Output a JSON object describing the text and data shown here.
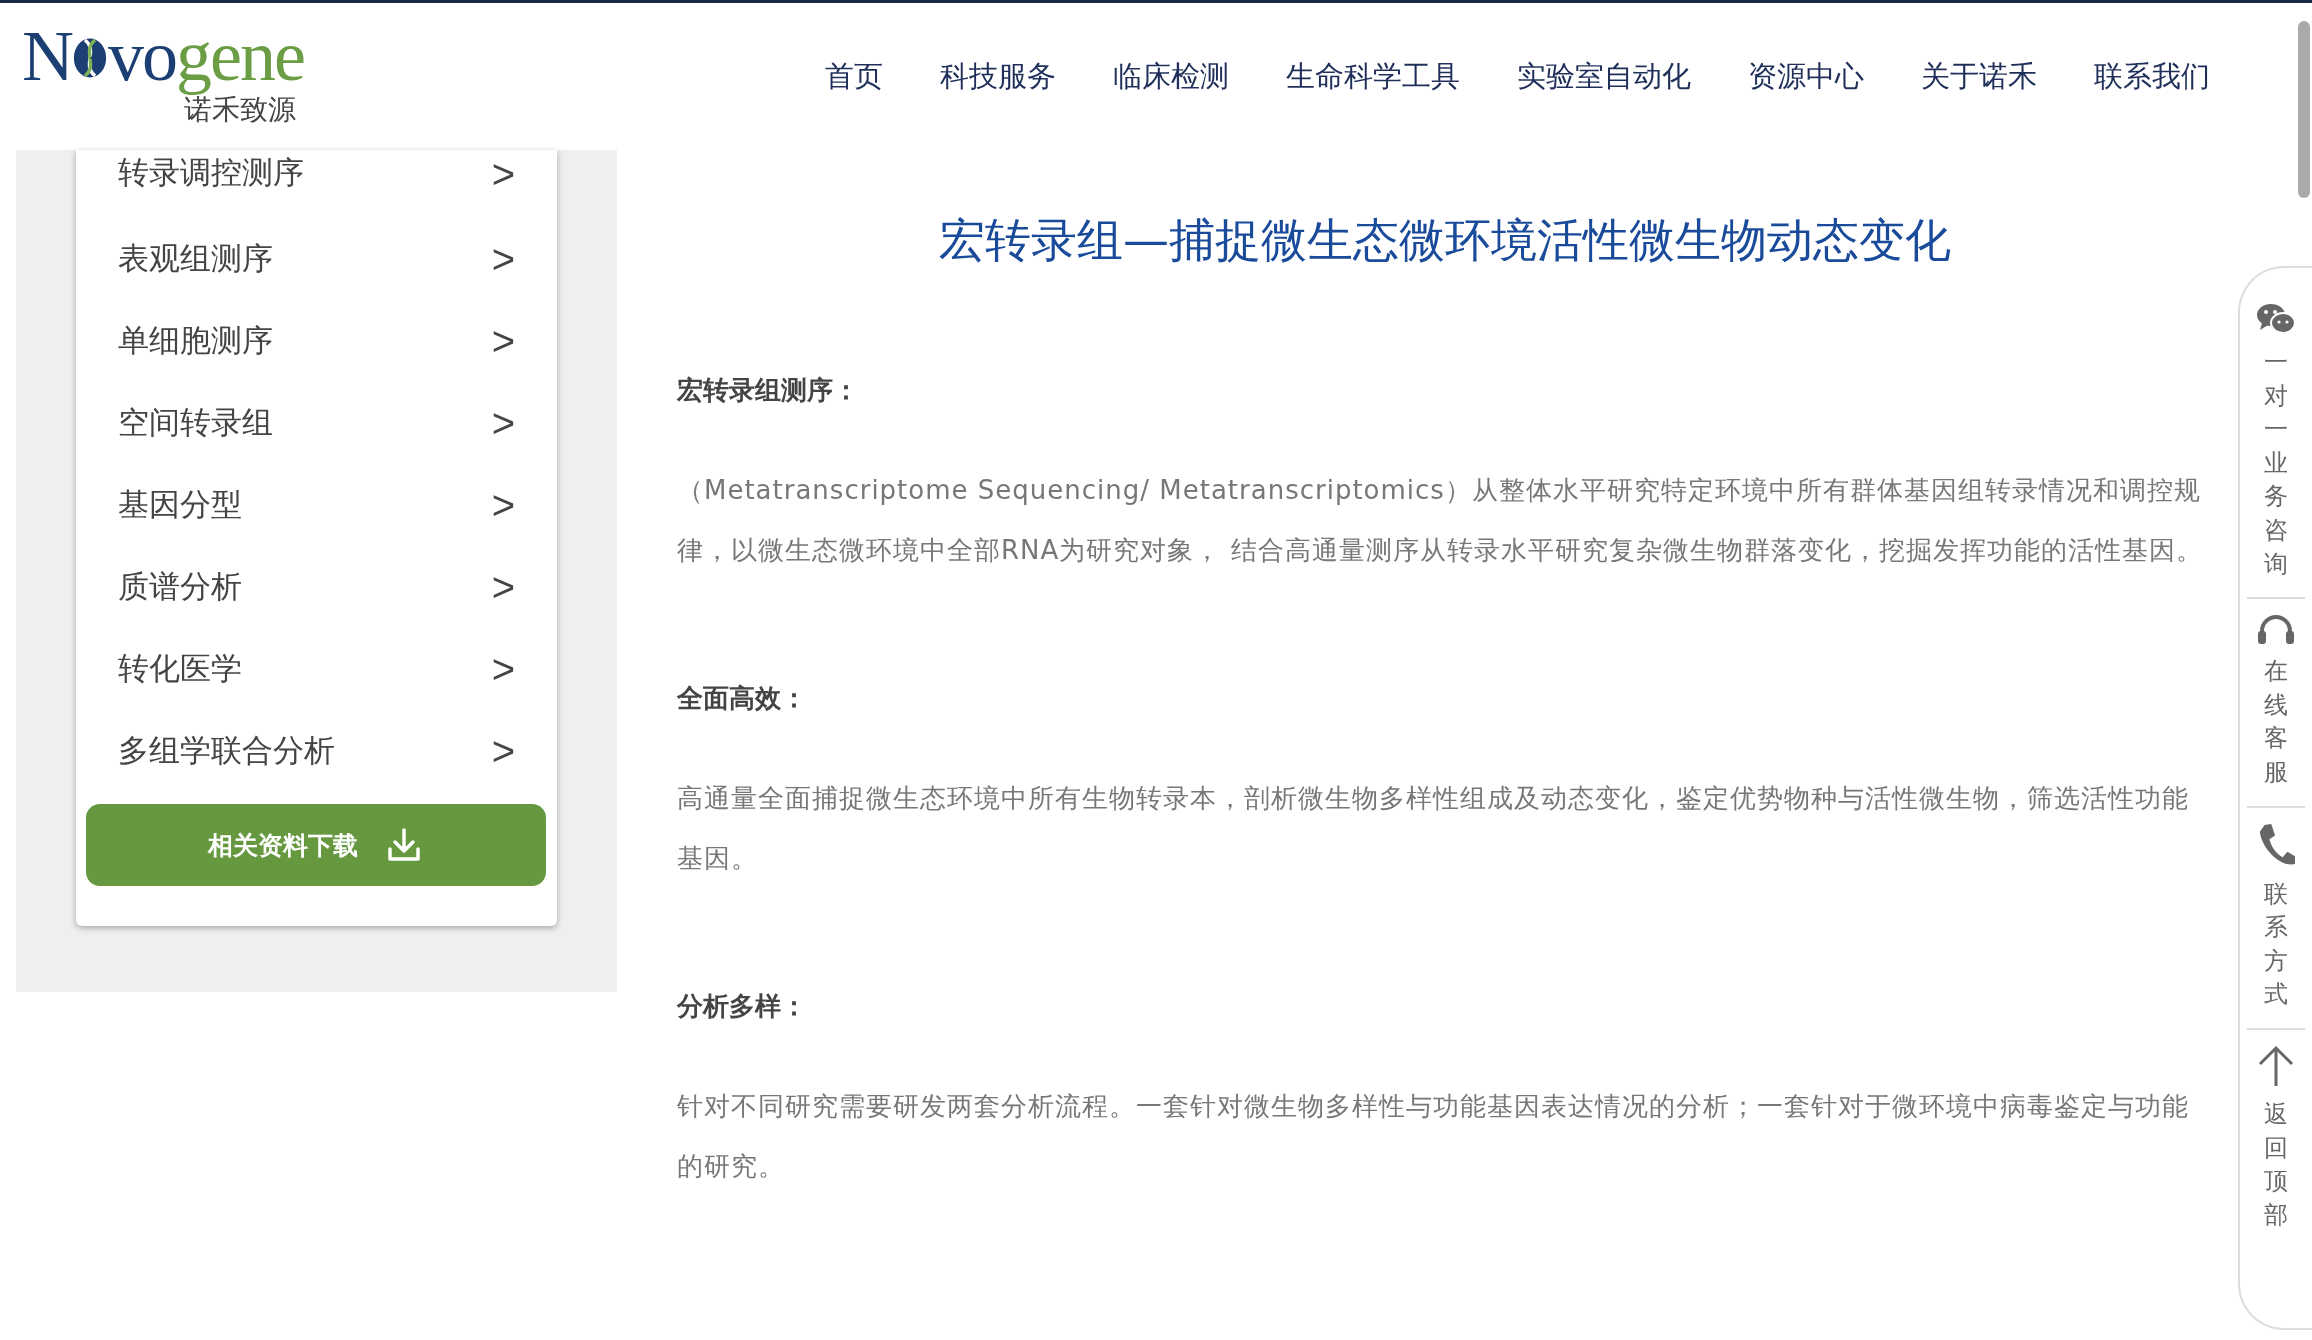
{
  "logo": {
    "part1": "N",
    "part2": "vo",
    "part3": "gene",
    "tagline": "诺禾致源"
  },
  "nav": [
    "首页",
    "科技服务",
    "临床检测",
    "生命科学工具",
    "实验室自动化",
    "资源中心",
    "关于诺禾",
    "联系我们"
  ],
  "sidebar": {
    "items": [
      {
        "label": "转录调控测序",
        "arrow": ">"
      },
      {
        "label": "表观组测序",
        "arrow": ">"
      },
      {
        "label": "单细胞测序",
        "arrow": ">"
      },
      {
        "label": "空间转录组",
        "arrow": ">"
      },
      {
        "label": "基因分型",
        "arrow": ">"
      },
      {
        "label": "质谱分析",
        "arrow": ">"
      },
      {
        "label": "转化医学",
        "arrow": ">"
      },
      {
        "label": "多组学联合分析",
        "arrow": ">"
      }
    ],
    "download_button": "相关资料下载"
  },
  "content": {
    "title": "宏转录组—捕捉微生态微环境活性微生物动态变化",
    "sections": [
      {
        "heading": "宏转录组测序：",
        "text": "（Metatranscriptome Sequencing/ Metatranscriptomics）从整体水平研究特定环境中所有群体基因组转录情况和调控规律，以微生态微环境中全部RNA为研究对象， 结合高通量测序从转录水平研究复杂微生物群落变化，挖掘发挥功能的活性基因。"
      },
      {
        "heading": "全面高效：",
        "text": "高通量全面捕捉微生态环境中所有生物转录本，剖析微生物多样性组成及动态变化，鉴定优势物种与活性微生物，筛选活性功能基因。"
      },
      {
        "heading": "分析多样：",
        "text": "针对不同研究需要研发两套分析流程。一套针对微生物多样性与功能基因表达情况的分析；一套针对于微环境中病毒鉴定与功能的研究。"
      }
    ]
  },
  "float_bar": [
    {
      "kind": "wechat",
      "label": "一对一业务咨询"
    },
    {
      "kind": "headset",
      "label": "在线客服"
    },
    {
      "kind": "phone",
      "label": "联系方式"
    },
    {
      "kind": "top",
      "label": "返回顶部"
    }
  ]
}
